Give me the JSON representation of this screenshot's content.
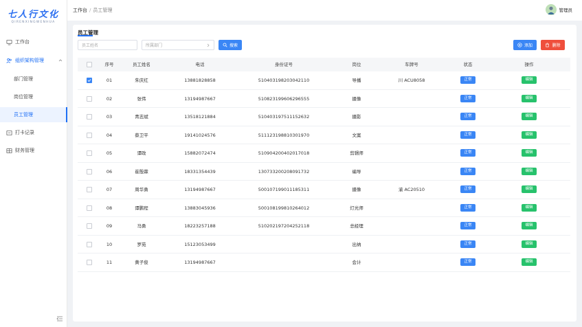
{
  "logo": {
    "main": "七人行文化",
    "sub": "QIRENXINGWENHUA"
  },
  "sidebar": {
    "items": [
      {
        "label": "工作台",
        "icon": "monitor-icon"
      },
      {
        "label": "组织架构管理",
        "icon": "org-icon"
      },
      {
        "label": "部门管理"
      },
      {
        "label": "岗位管理"
      },
      {
        "label": "员工管理"
      },
      {
        "label": "打卡记录",
        "icon": "calendar-icon"
      },
      {
        "label": "财务管理",
        "icon": "finance-icon"
      }
    ]
  },
  "header": {
    "breadcrumb": [
      "工作台",
      "员工管理"
    ],
    "separator": "/",
    "user_name": "管理员"
  },
  "page": {
    "title": "员工管理",
    "search_name_placeholder": "员工姓名",
    "search_dept_placeholder": "所属部门",
    "search_button": "搜索",
    "add_button": "添加",
    "delete_button": "删除"
  },
  "table": {
    "columns": [
      "序号",
      "员工姓名",
      "电话",
      "身份证号",
      "岗位",
      "车牌号",
      "状态",
      "操作"
    ],
    "rows": [
      {
        "no": "01",
        "name": "朱庆红",
        "phone": "13881828858",
        "id": "510403198203042110",
        "post": "导播",
        "plate": "川 ACU8058",
        "status": "正常",
        "action": "编辑",
        "checked": true
      },
      {
        "no": "02",
        "name": "张伟",
        "phone": "13194987667",
        "id": "510823199606296555",
        "post": "摄像",
        "plate": "",
        "status": "正常",
        "action": "编辑",
        "checked": false
      },
      {
        "no": "03",
        "name": "青志斌",
        "phone": "13518121884",
        "id": "510403197511152632",
        "post": "摄影",
        "plate": "",
        "status": "正常",
        "action": "编辑",
        "checked": false
      },
      {
        "no": "04",
        "name": "蔡卫平",
        "phone": "19141024576",
        "id": "511123198810301970",
        "post": "文案",
        "plate": "",
        "status": "正常",
        "action": "编辑",
        "checked": false
      },
      {
        "no": "05",
        "name": "谭政",
        "phone": "15882072474",
        "id": "510904200402017018",
        "post": "剪辑师",
        "plate": "",
        "status": "正常",
        "action": "编辑",
        "checked": false
      },
      {
        "no": "06",
        "name": "崔殷霖",
        "phone": "18331354439",
        "id": "130733200208091732",
        "post": "编导",
        "plate": "",
        "status": "正常",
        "action": "编辑",
        "checked": false
      },
      {
        "no": "07",
        "name": "周华勇",
        "phone": "13194987667",
        "id": "500107199011185311",
        "post": "摄像",
        "plate": "渝 AC20510",
        "status": "正常",
        "action": "编辑",
        "checked": false
      },
      {
        "no": "08",
        "name": "谭鹏程",
        "phone": "13883045936",
        "id": "500108199810264012",
        "post": "灯光师",
        "plate": "",
        "status": "正常",
        "action": "编辑",
        "checked": false
      },
      {
        "no": "09",
        "name": "马勇",
        "phone": "18223257188",
        "id": "510202197204252118",
        "post": "总经理",
        "plate": "",
        "status": "正常",
        "action": "编辑",
        "checked": false
      },
      {
        "no": "10",
        "name": "罗苑",
        "phone": "15123053499",
        "id": "",
        "post": "出纳",
        "plate": "",
        "status": "正常",
        "action": "编辑",
        "checked": false
      },
      {
        "no": "11",
        "name": "黄子俊",
        "phone": "13194987667",
        "id": "",
        "post": "会计",
        "plate": "",
        "status": "正常",
        "action": "编辑",
        "checked": false
      }
    ]
  },
  "colors": {
    "primary": "#3a86f5",
    "danger": "#ef4f3c",
    "success": "#27c26c",
    "brand": "#2a6ef0"
  }
}
